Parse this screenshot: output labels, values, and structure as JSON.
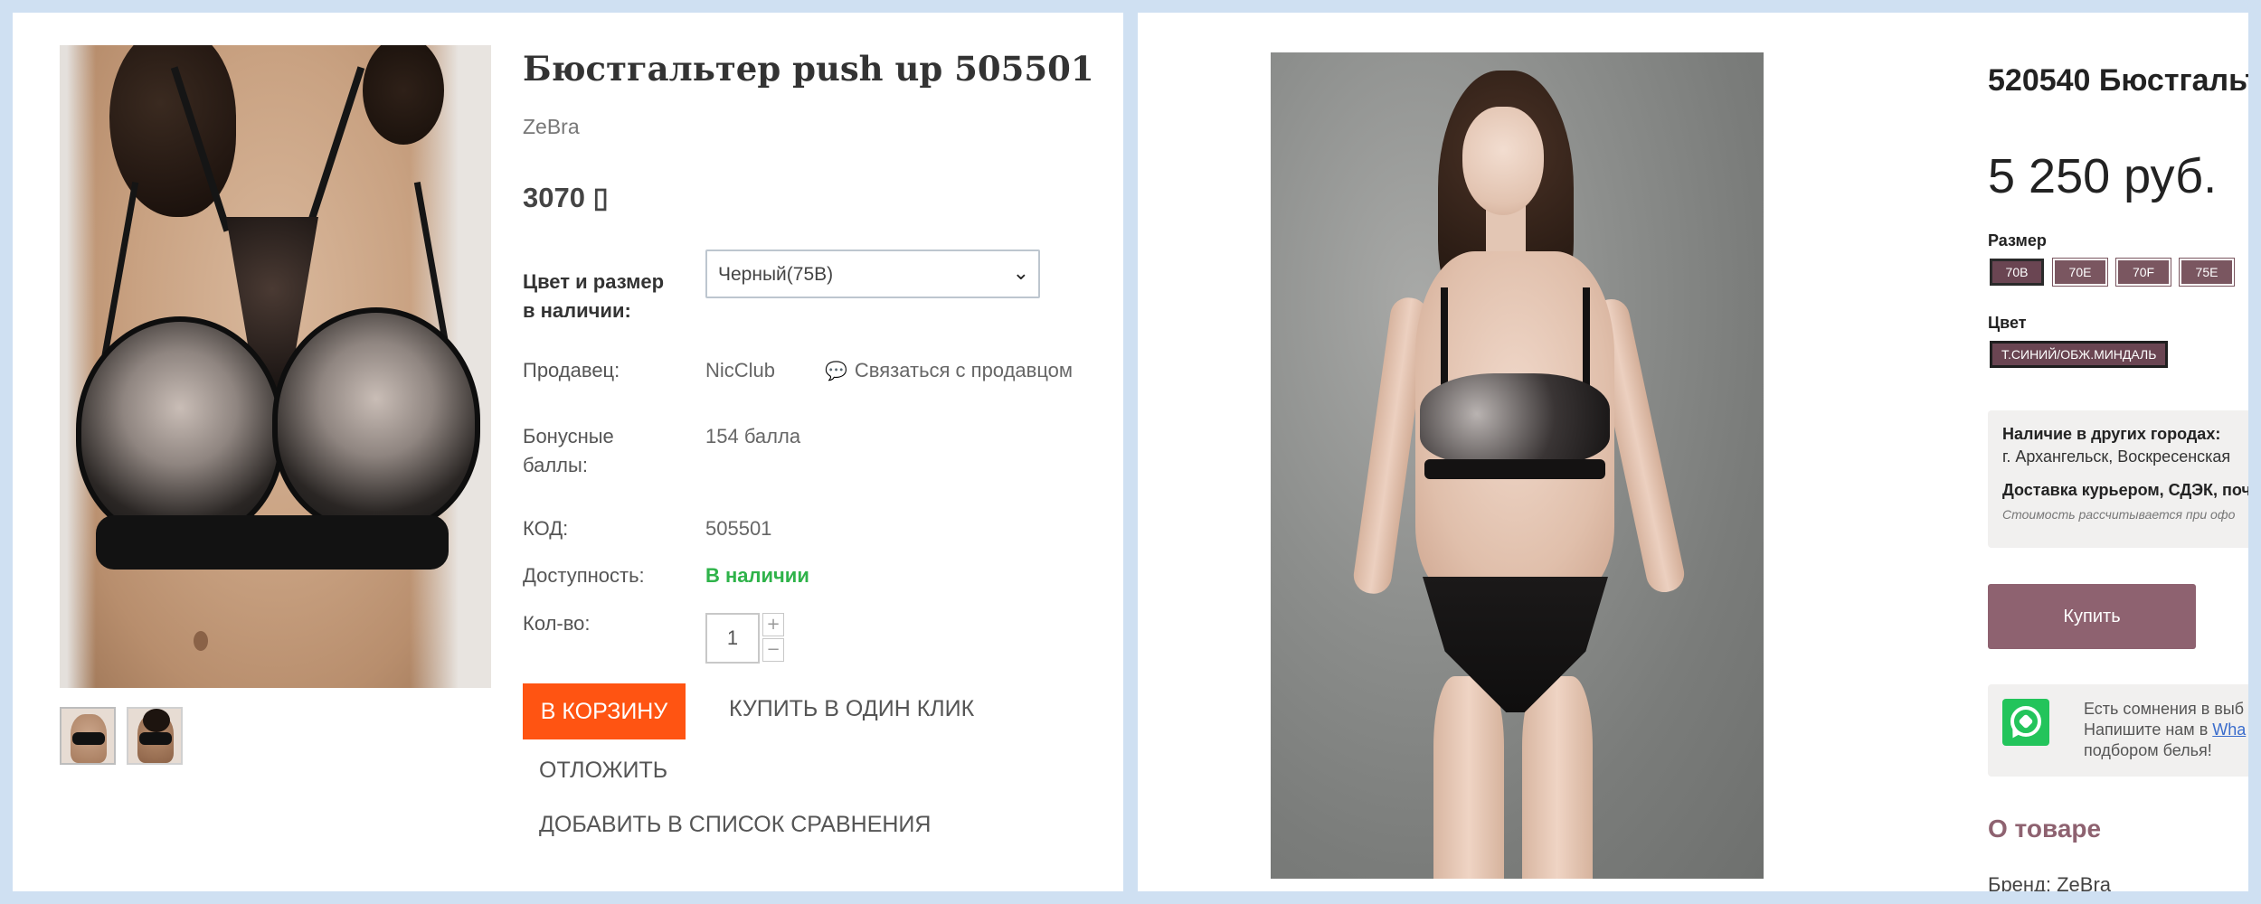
{
  "left": {
    "title": "Бюстгальтер push up 505501",
    "brand": "ZeBra",
    "price": "3070 ▯",
    "color_size_label_line1": "Цвет и размер",
    "color_size_label_line2": "в наличии:",
    "color_size_selected": "Черный(75В)",
    "seller_label": "Продавец:",
    "seller_value": "NicClub",
    "contact_seller": "Связаться с продавцом",
    "bonus_label_line1": "Бонусные",
    "bonus_label_line2": "баллы:",
    "bonus_value": "154 балла",
    "code_label": "КОД:",
    "code_value": "505501",
    "availability_label": "Доступность:",
    "availability_value": "В наличии",
    "qty_label": "Кол-во:",
    "qty_value": "1",
    "add_to_cart": "В КОРЗИНУ",
    "buy_one_click": "КУПИТЬ В ОДИН КЛИК",
    "postpone": "ОТЛОЖИТЬ",
    "add_compare": "ДОБАВИТЬ В СПИСОК СРАВНЕНИЯ"
  },
  "right": {
    "title": "520540 Бюстгальт",
    "price": "5 250 руб.",
    "size_label": "Размер",
    "sizes": [
      "70B",
      "70E",
      "70F",
      "75E"
    ],
    "selected_size": "70B",
    "color_label": "Цвет",
    "color_value": "Т.СИНИЙ/ОБЖ.МИНДАЛЬ",
    "stock_heading": "Наличие в других городах:",
    "stock_text": "г. Архангельск, Воскресенская",
    "delivery_heading": "Доставка курьером, СДЭК, поч",
    "delivery_note": "Стоимость рассчитывается при офо",
    "buy_button": "Купить",
    "wa_line1": "Есть сомнения в выб",
    "wa_line2_prefix": "Напишите нам в ",
    "wa_line2_link": "Wha",
    "wa_line3": "подбором белья!",
    "about_heading": "О товаре",
    "brand_line": "Бренд: ZeBra"
  },
  "colors": {
    "accent_orange": "#ff5412",
    "in_stock_green": "#2fb34a",
    "mauve": "#8e6270",
    "whatsapp_green": "#23c45b"
  }
}
